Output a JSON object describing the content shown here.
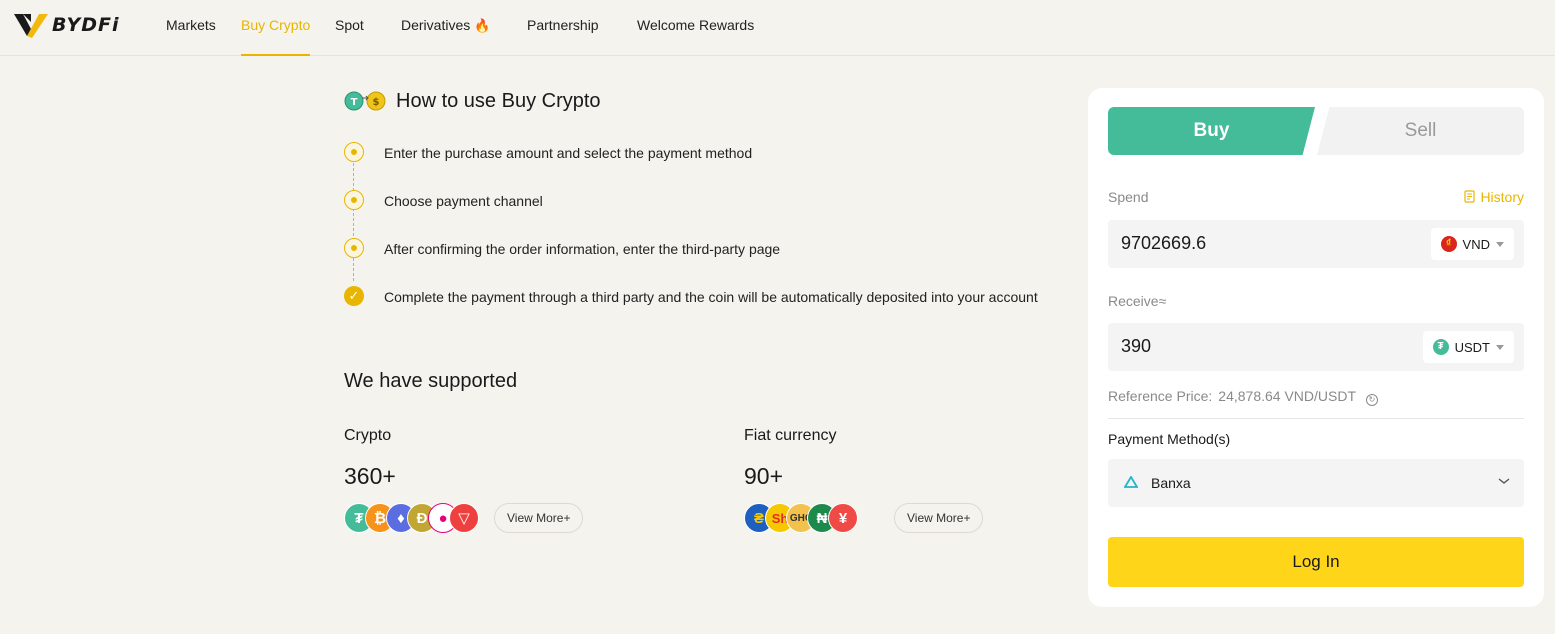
{
  "nav": {
    "logo_text": "BYDFi",
    "items": [
      {
        "label": "Markets"
      },
      {
        "label": "Buy Crypto"
      },
      {
        "label": "Spot"
      },
      {
        "label": "Derivatives"
      },
      {
        "label": "Partnership"
      },
      {
        "label": "Welcome Rewards"
      }
    ],
    "active_index": 1,
    "accent_color": "#e8b600"
  },
  "howto": {
    "title": "How to use Buy Crypto",
    "steps": [
      {
        "text": "Enter the purchase amount and select the payment method"
      },
      {
        "text": "Choose payment channel"
      },
      {
        "text": "After confirming the order information, enter the third-party page"
      },
      {
        "text": "Complete the payment through a third party and the coin will be automatically deposited into your account"
      }
    ]
  },
  "supported": {
    "title": "We have supported",
    "crypto": {
      "label": "Crypto",
      "count": "360+",
      "view_more": "View More+",
      "icons": [
        "usdt-icon",
        "bitcoin-icon",
        "ethereum-icon",
        "dogecoin-icon",
        "polkadot-icon",
        "tron-icon"
      ]
    },
    "fiat": {
      "label": "Fiat currency",
      "count": "90+",
      "view_more": "View More+",
      "icons": [
        "ghs-cedi-icon",
        "ugx-shilling-icon",
        "ghc-icon",
        "ngn-naira-icon",
        "jpy-yen-icon"
      ],
      "icon_texts": [
        "₴",
        "Sh",
        "GHC",
        "₦",
        "¥"
      ]
    }
  },
  "trade": {
    "buy_label": "Buy",
    "sell_label": "Sell",
    "buy_color": "#45bc99",
    "spend_label": "Spend",
    "history_label": "History",
    "spend_value": "9702669.6",
    "spend_currency": "VND",
    "receive_label": "Receive≈",
    "receive_value": "390",
    "receive_currency": "USDT",
    "ref_label": "Reference Price:",
    "ref_value": "24,878.64 VND/USDT",
    "payment_label": "Payment Method(s)",
    "payment_method": "Banxa",
    "login_label": "Log In",
    "login_color": "#ffd51a"
  }
}
